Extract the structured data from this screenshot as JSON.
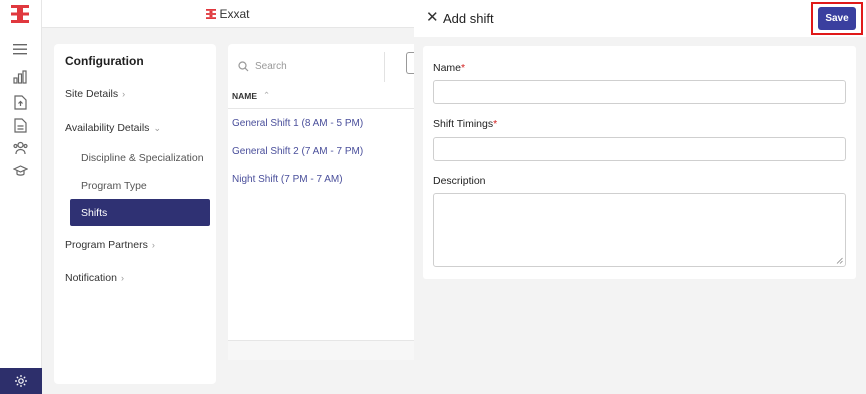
{
  "brand": {
    "name": "Exxat",
    "accent": "#e0383e",
    "rail_accent": "#2d2f6b"
  },
  "rail": {
    "icons": [
      "menu-icon",
      "bar-chart-icon",
      "document-upload-icon",
      "document-list-icon",
      "users-icon",
      "graduation-cap-icon"
    ],
    "bottom_icon": "settings-icon"
  },
  "config": {
    "title": "Configuration",
    "items": [
      {
        "label": "Site Details",
        "expanded": false
      },
      {
        "label": "Availability Details",
        "expanded": true
      },
      {
        "label": "Program Partners",
        "expanded": false
      },
      {
        "label": "Notification",
        "expanded": false
      }
    ],
    "sub_items": [
      "Discipline & Specialization",
      "Program Type",
      "Shifts"
    ],
    "active_sub_item": "Shifts"
  },
  "list": {
    "search_placeholder": "Search",
    "column_header": "NAME",
    "rows": [
      "General Shift 1 (8 AM - 5 PM)",
      "General Shift 2 (7 AM - 7 PM)",
      "Night Shift (7 PM - 7 AM)"
    ]
  },
  "drawer": {
    "title": "Add shift",
    "save_label": "Save",
    "fields": [
      {
        "label": "Name",
        "required": true,
        "value": ""
      },
      {
        "label": "Shift Timings",
        "required": true,
        "value": ""
      },
      {
        "label": "Description",
        "required": false,
        "value": ""
      }
    ]
  }
}
